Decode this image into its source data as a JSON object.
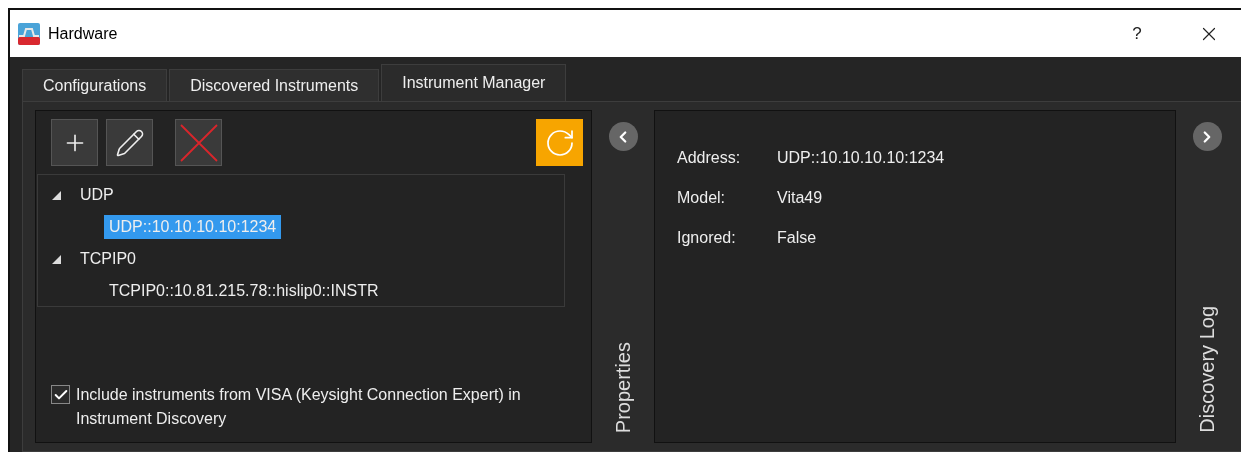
{
  "window": {
    "title": "Hardware",
    "help": "?"
  },
  "tabs": [
    {
      "label": "Configurations",
      "selected": false
    },
    {
      "label": "Discovered Instruments",
      "selected": false
    },
    {
      "label": "Instrument Manager",
      "selected": true
    }
  ],
  "toolbar": [
    {
      "kind": "add"
    },
    {
      "kind": "edit"
    },
    {
      "kind": "delete"
    },
    {
      "kind": "refresh"
    }
  ],
  "tree": [
    {
      "label": "UDP",
      "expanded": true,
      "selected": false,
      "children": [
        {
          "label": "UDP::10.10.10.10:1234",
          "selected": true
        }
      ]
    },
    {
      "label": "TCPIP0",
      "expanded": true,
      "selected": false,
      "children": [
        {
          "label": "TCPIP0::10.81.215.78::hislip0::INSTR",
          "selected": false
        }
      ]
    }
  ],
  "include_visa": {
    "label": "Include instruments from VISA (Keysight Connection Expert) in Instrument Discovery",
    "checked": true
  },
  "properties_pane": {
    "title": "Properties"
  },
  "properties": [
    {
      "label": "Address:",
      "value": "UDP::10.10.10.10:1234"
    },
    {
      "label": "Model:",
      "value": "Vita49"
    },
    {
      "label": "Ignored:",
      "value": "False"
    }
  ],
  "discovery_log": {
    "title": "Discovery Log"
  }
}
